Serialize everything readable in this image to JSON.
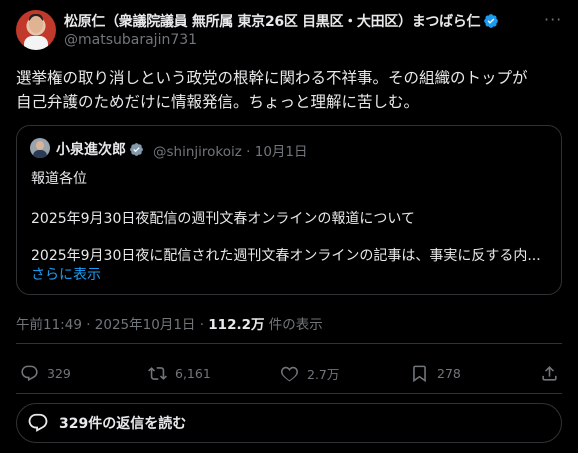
{
  "post": {
    "author_name": "松原仁（衆議院議員 無所属 東京26区 目黒区・大田区）まつばら仁",
    "author_handle": "@matsubarajin731",
    "more_label": "···",
    "text_line1": "選挙権の取り消しという政党の根幹に関わる不祥事。その組織のトップが",
    "text_line2": "自己弁護のためだけに情報発信。ちょっと理解に苦しむ。"
  },
  "quote": {
    "author_name": "小泉進次郎",
    "handle": "@shinjirokoiz",
    "separator": "·",
    "date": "10月1日",
    "line1": "報道各位",
    "line2": "2025年9月30日夜配信の週刊文春オンラインの報道について",
    "line3": "2025年9月30日夜に配信された週刊文春オンラインの記事は、事実に反する内...",
    "show_more": "さらに表示"
  },
  "meta": {
    "time": "午前11:49 · 2025年10月1日 · ",
    "views_count": "112.2万",
    "views_label": " 件の表示"
  },
  "actions": {
    "replies": "329",
    "reposts": "6,161",
    "likes": "2.7万",
    "bookmarks": "278"
  },
  "read_replies_label": "329件の返信を読む",
  "colors": {
    "background": "#000000",
    "text": "#e7e9ea",
    "muted": "#71767b",
    "accent": "#1d9bf0",
    "border": "#2f3336"
  },
  "icons": [
    "verified-badge-icon",
    "more-icon",
    "reply-icon",
    "repost-icon",
    "like-icon",
    "bookmark-icon",
    "share-icon",
    "speech-bubble-icon"
  ]
}
